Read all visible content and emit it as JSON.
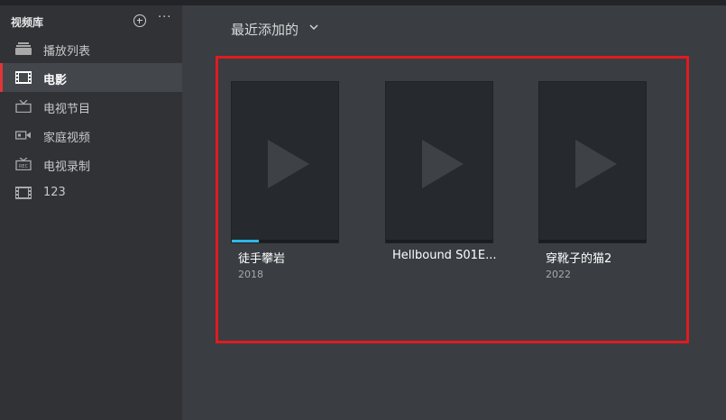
{
  "library": {
    "title": "视频库",
    "add_icon": "plus-circle-icon",
    "more_icon": "more-icon",
    "more_label": "···"
  },
  "nav": [
    {
      "label": "播放列表",
      "icon": "playlist-icon",
      "active": false
    },
    {
      "label": "电影",
      "icon": "film-icon",
      "active": true
    },
    {
      "label": "电视节目",
      "icon": "tv-icon",
      "active": false
    },
    {
      "label": "家庭视频",
      "icon": "camcorder-icon",
      "active": false
    },
    {
      "label": "电视录制",
      "icon": "tv-record-icon",
      "active": false
    },
    {
      "label": "123",
      "icon": "film-icon",
      "active": false
    }
  ],
  "sort": {
    "label": "最近添加的",
    "icon": "chevron-down-icon"
  },
  "colors": {
    "accent": "#e0363a",
    "progress": "#2fb7e8",
    "highlight": "#e01b1f"
  },
  "movies": [
    {
      "title": "徒手攀岩",
      "year": "2018",
      "progress": 0.25
    },
    {
      "title": "Hellbound S01E...",
      "year": "",
      "progress": 0
    },
    {
      "title": "穿靴子的猫2",
      "year": "2022",
      "progress": 0
    }
  ]
}
